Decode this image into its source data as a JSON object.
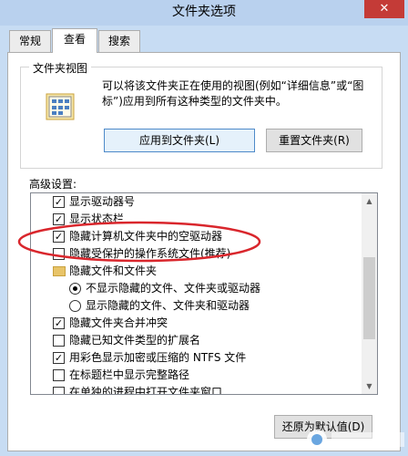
{
  "window": {
    "title": "文件夹选项",
    "close_glyph": "✕"
  },
  "tabs": [
    {
      "label": "常规",
      "active": false
    },
    {
      "label": "查看",
      "active": true
    },
    {
      "label": "搜索",
      "active": false
    }
  ],
  "folder_view": {
    "title": "文件夹视图",
    "description": "可以将该文件夹正在使用的视图(例如“详细信息”或“图标”)应用到所有这种类型的文件夹中。",
    "apply_label": "应用到文件夹(L)",
    "reset_label": "重置文件夹(R)",
    "icon": "folder-view-icon"
  },
  "advanced": {
    "label": "高级设置:",
    "items": [
      {
        "type": "checkbox",
        "checked": true,
        "label": "显示驱动器号"
      },
      {
        "type": "checkbox",
        "checked": true,
        "label": "显示状态栏"
      },
      {
        "type": "checkbox",
        "checked": true,
        "label": "隐藏计算机文件夹中的空驱动器"
      },
      {
        "type": "checkbox",
        "checked": false,
        "label": "隐藏受保护的操作系统文件(推荐)"
      },
      {
        "type": "folder",
        "label": "隐藏文件和文件夹"
      },
      {
        "type": "radio",
        "checked": true,
        "label": "不显示隐藏的文件、文件夹或驱动器"
      },
      {
        "type": "radio",
        "checked": false,
        "label": "显示隐藏的文件、文件夹和驱动器"
      },
      {
        "type": "checkbox",
        "checked": true,
        "label": "隐藏文件夹合并冲突"
      },
      {
        "type": "checkbox",
        "checked": false,
        "label": "隐藏已知文件类型的扩展名"
      },
      {
        "type": "checkbox",
        "checked": true,
        "label": "用彩色显示加密或压缩的 NTFS 文件"
      },
      {
        "type": "checkbox",
        "checked": false,
        "label": "在标题栏中显示完整路径"
      },
      {
        "type": "checkbox",
        "checked": false,
        "label": "在单独的进程中打开文件夹窗口"
      }
    ],
    "restore_label": "还原为默认值(D)"
  },
  "colors": {
    "highlight_ellipse": "#d9262c",
    "window_bg": "#c7dcf3"
  }
}
